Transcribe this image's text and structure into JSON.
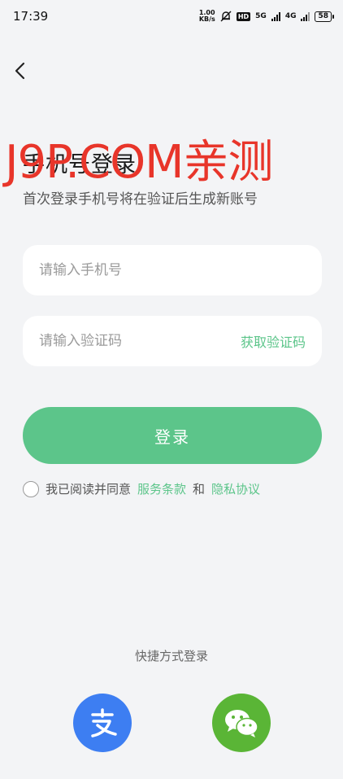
{
  "status_bar": {
    "time": "17:39",
    "net_speed_value": "1.00",
    "net_speed_unit": "KB/s",
    "hd_label": "HD",
    "sig1_label": "5G",
    "sig2_label": "4G",
    "battery": "58"
  },
  "header": {
    "title": "手机号登录",
    "subtitle": "首次登录手机号将在验证后生成新账号"
  },
  "watermark": "J9P.COM亲测",
  "form": {
    "phone_placeholder": "请输入手机号",
    "code_placeholder": "请输入验证码",
    "get_code_label": "获取验证码",
    "login_label": "登录"
  },
  "agreement": {
    "prefix": "我已阅读并同意",
    "terms_label": "服务条款",
    "and": "和",
    "privacy_label": "隐私协议"
  },
  "quick_login": {
    "title": "快捷方式登录"
  },
  "colors": {
    "accent": "#5cc58a",
    "alipay": "#3d7ef2",
    "wechat": "#5ab536",
    "watermark": "#e8352a"
  }
}
